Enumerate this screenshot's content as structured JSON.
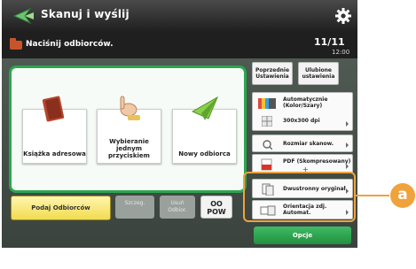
{
  "header": {
    "title": "Skanuj i wyślij",
    "status_text": "Naciśnij odbiorców.",
    "clock_time": "11/11",
    "clock_date": "12:00"
  },
  "main_buttons": [
    {
      "label": "Książka adresowa",
      "icon": "address-book-icon"
    },
    {
      "label": "Wybieranie\njednym przyciskiem",
      "icon": "one-touch-icon"
    },
    {
      "label": "Nowy odbiorca",
      "icon": "new-recipient-icon"
    }
  ],
  "bottom_row": {
    "recipients_label": "Podaj Odbiorców",
    "settings_label": "Szczeg.",
    "delete_label": "Usuń\nOdbior.",
    "oo_label": "OO\nPOW"
  },
  "right_panel": {
    "recall_label": "Poprzednie\nUstawienia",
    "favorites_label": "Ulubione\nustawienia",
    "color_line1": "Automatycznie",
    "color_line2": "(Kolor/Szary)",
    "resolution": "300x300 dpi",
    "size_label": "Rozmiar skanow.",
    "format_label": "PDF (Skompresowany)",
    "doc_type_label": "Dwustronny oryginał",
    "orientation_label": "Orientacja zdj.\nAutomat."
  },
  "options_label": "Opcje",
  "callout": "a"
}
